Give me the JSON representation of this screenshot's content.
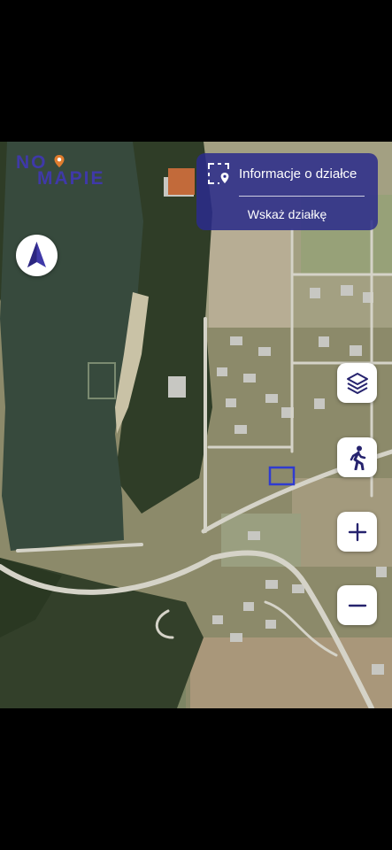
{
  "logo": {
    "line1": "NO",
    "line2": "MAPIE"
  },
  "panel": {
    "info_label": "Informacje o działce",
    "point_label": "Wskaż działkę"
  },
  "controls": {
    "compass_icon": "north-arrow-icon",
    "layers_icon": "layers-icon",
    "walk_icon": "walking-person-icon",
    "zoom_in_icon": "plus-icon",
    "zoom_out_icon": "minus-icon"
  },
  "colors": {
    "brand": "#3f39a8",
    "panel_bg": "#2b2b8c",
    "icon": "#26236e",
    "parcel_outline": "#2f3bd0"
  }
}
